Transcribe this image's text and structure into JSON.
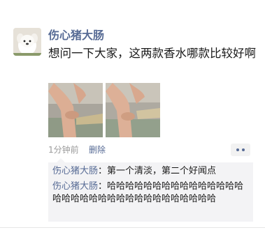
{
  "post": {
    "author": "伤心猪大肠",
    "content": "想问一下大家，这两款香水哪款比较好啊",
    "images": [
      {
        "name": "wrist-photo-1"
      },
      {
        "name": "wrist-photo-2"
      }
    ],
    "time": "1分钟前",
    "delete_label": "删除"
  },
  "comments": [
    {
      "name": "伤心猪大肠",
      "separator": "：",
      "text": "第一个清淡，第二个好闻点"
    },
    {
      "name": "伤心猪大肠",
      "separator": "：",
      "text": "哈哈哈哈哈哈哈哈哈哈哈哈哈哈哈哈哈哈哈哈哈哈哈哈哈哈哈哈哈哈哈哈哈"
    }
  ],
  "colors": {
    "link": "#576b95",
    "text": "#191919",
    "meta": "#9a9a9a",
    "comment_bg": "#f3f3f5"
  }
}
